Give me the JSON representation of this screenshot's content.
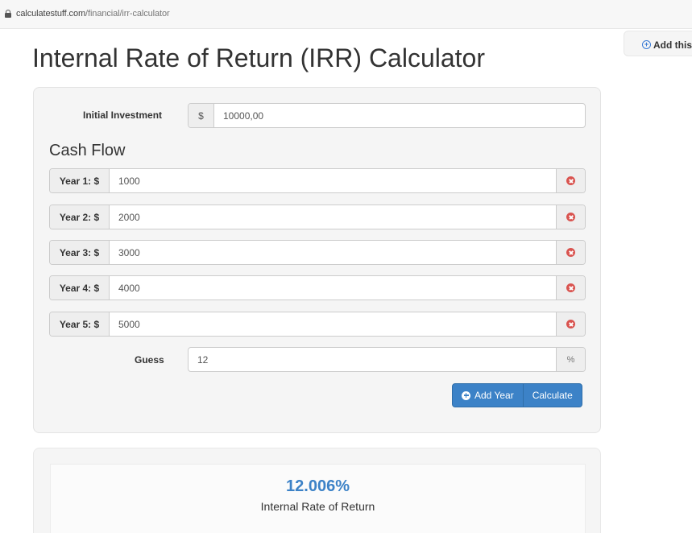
{
  "browser": {
    "url_domain": "calculatestuff.com",
    "url_path": "/financial/irr-calculator"
  },
  "add_this": {
    "label": "Add this"
  },
  "page": {
    "title": "Internal Rate of Return (IRR) Calculator"
  },
  "form": {
    "initial_investment": {
      "label": "Initial Investment",
      "currency": "$",
      "value": "10000,00"
    },
    "cash_flow_heading": "Cash Flow",
    "years": [
      {
        "label": "Year 1: $",
        "value": "1000"
      },
      {
        "label": "Year 2: $",
        "value": "2000"
      },
      {
        "label": "Year 3: $",
        "value": "3000"
      },
      {
        "label": "Year 4: $",
        "value": "4000"
      },
      {
        "label": "Year 5: $",
        "value": "5000"
      }
    ],
    "guess": {
      "label": "Guess",
      "value": "12",
      "unit": "%"
    },
    "add_year_label": "Add Year",
    "calculate_label": "Calculate"
  },
  "result": {
    "value": "12.006%",
    "label": "Internal Rate of Return"
  },
  "colors": {
    "accent": "#3c82c7",
    "remove": "#d9534f"
  }
}
